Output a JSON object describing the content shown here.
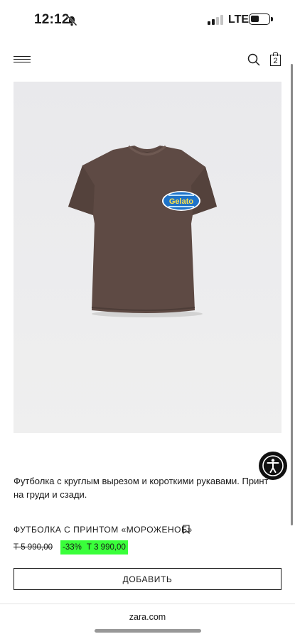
{
  "status_bar": {
    "time": "12:12",
    "network": "LTE",
    "icons": [
      "bell-off-icon",
      "signal-icon",
      "battery-icon"
    ]
  },
  "header": {
    "icons": [
      "menu-icon",
      "search-icon",
      "shopping-bag-icon"
    ],
    "bag_count": "2"
  },
  "product": {
    "image_icon": "product-photo",
    "print_text": [
      "Gelato"
    ],
    "description": "Футболка с круглым вырезом и короткими рукавами. Принт на груди и сзади.",
    "title": "ФУТБОЛКА С ПРИНТОМ «МОРОЖЕНОЕ»",
    "price_old": "Т 5 990,00",
    "discount": "-33%",
    "price_new": "Т 3 990,00",
    "add_label": "ДОБАВИТЬ"
  },
  "accessibility": {
    "icon": "accessibility-icon"
  },
  "browser": {
    "url": "zara.com"
  },
  "colors": {
    "discount_badge": "#39ff3a",
    "background": "#ffffff",
    "image_background": "#ebebeb",
    "shirt": "#5e4a44",
    "print_blue": "#1e73c8",
    "text": "#1a1a1a"
  }
}
